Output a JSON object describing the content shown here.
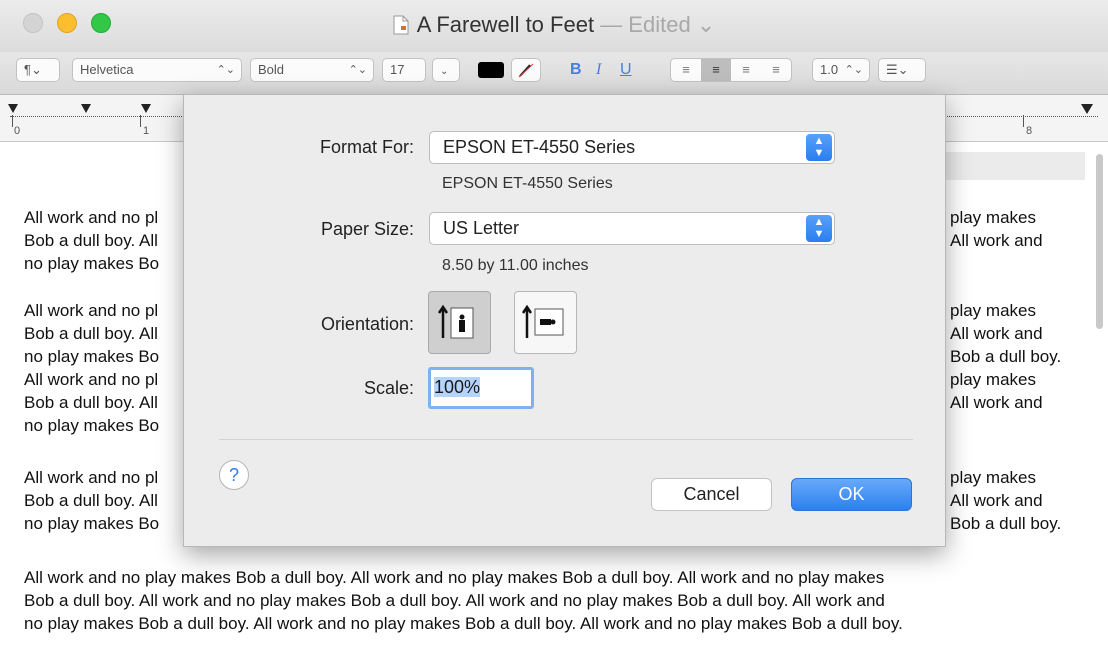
{
  "window": {
    "title": "A Farewell to Feet",
    "edited_label": "— Edited ⌄"
  },
  "toolbar": {
    "paragraph_style": "¶⌄",
    "font_family": "Helvetica",
    "font_style": "Bold",
    "font_size": "17",
    "bold": "B",
    "italic": "I",
    "underline": "U",
    "line_spacing": "1.0",
    "text_color": "#000000",
    "highlight_color": "#ffffff"
  },
  "ruler": {
    "marks": [
      "0",
      "1",
      "8"
    ]
  },
  "document": {
    "para1_left": [
      "All work and no pl",
      "Bob a dull boy. All",
      "no play makes Bo"
    ],
    "para1_right": [
      "play makes",
      "All work and"
    ],
    "para2_left": [
      "All work and no pl",
      "Bob a dull boy. All",
      "no play makes Bo",
      "All work and no pl",
      "Bob a dull boy. All",
      "no play makes Bo"
    ],
    "para2_right": [
      "play makes",
      "All work and",
      "Bob a dull boy.",
      "play makes",
      "All work and"
    ],
    "para3_left": [
      "All work and no pl",
      "Bob a dull boy. All",
      "no play makes Bo"
    ],
    "para3_right": [
      "play makes",
      "All work and",
      "Bob a dull boy."
    ],
    "para4": [
      "All work and no play makes Bob a dull boy. All work and no play makes Bob a dull boy. All work and no play makes",
      "Bob a dull boy. All work and no play makes Bob a dull boy. All work and no play makes Bob a dull boy. All work and",
      "no play makes Bob a dull boy. All work and no play makes Bob a dull boy. All work and no play makes Bob a dull boy."
    ]
  },
  "dialog": {
    "format_for_label": "Format For:",
    "format_for_value": "EPSON ET-4550 Series",
    "format_for_sub": "EPSON ET-4550 Series",
    "paper_size_label": "Paper Size:",
    "paper_size_value": "US Letter",
    "paper_size_sub": "8.50 by 11.00 inches",
    "orientation_label": "Orientation:",
    "orientation_selected": "portrait",
    "scale_label": "Scale:",
    "scale_value": "100%",
    "help_label": "?",
    "cancel_label": "Cancel",
    "ok_label": "OK"
  }
}
